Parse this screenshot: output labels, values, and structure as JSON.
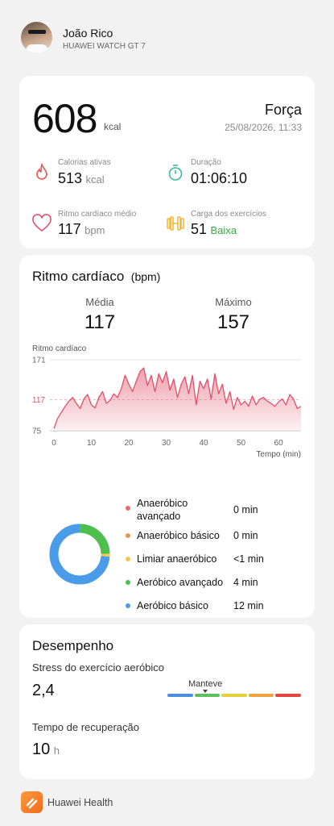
{
  "header": {
    "user_name": "João Rico",
    "device": "HUAWEI WATCH GT 7"
  },
  "summary": {
    "calories": "608",
    "calories_unit": "kcal",
    "workout_type": "Força",
    "datetime": "25/08/2026, 11:33",
    "stats": [
      {
        "label": "Calorias ativas",
        "value": "513",
        "unit": "kcal",
        "icon": "flame-icon"
      },
      {
        "label": "Duração",
        "value": "01:06:10",
        "unit": "",
        "icon": "stopwatch-icon"
      },
      {
        "label": "Ritmo cardíaco médio",
        "value": "117",
        "unit": "bpm",
        "icon": "heart-icon"
      },
      {
        "label": "Carga dos exercícios",
        "value": "51",
        "unit": "Baixa",
        "icon": "dumbbell-icon"
      }
    ],
    "colors": {
      "flame": "#e8584f",
      "stopwatch": "#3bb8a0",
      "heart": "#e0506a",
      "dumbbell": "#f2b233",
      "low_load": "#3aa845"
    }
  },
  "heart_rate": {
    "title": "Ritmo cardíaco",
    "unit": "(bpm)",
    "avg_label": "Média",
    "avg_value": "117",
    "max_label": "Máximo",
    "max_value": "157",
    "chart_label": "Ritmo cardíaco",
    "x_axis_label": "Tempo (min)"
  },
  "chart_data": {
    "type": "area",
    "title": "",
    "xlabel": "Tempo (min)",
    "ylabel": "Ritmo cardíaco",
    "xlim": [
      0,
      66
    ],
    "ylim": [
      75,
      171
    ],
    "x_ticks": [
      0,
      10,
      20,
      30,
      40,
      50,
      60
    ],
    "y_ticks": [
      75,
      117,
      171
    ],
    "highlight_y": 117,
    "color": "#e0506a",
    "x": [
      0,
      1,
      2,
      3,
      4,
      5,
      6,
      7,
      8,
      9,
      10,
      11,
      12,
      13,
      14,
      15,
      16,
      17,
      18,
      19,
      20,
      21,
      22,
      23,
      24,
      25,
      26,
      27,
      28,
      29,
      30,
      31,
      32,
      33,
      34,
      35,
      36,
      37,
      38,
      39,
      40,
      41,
      42,
      43,
      44,
      45,
      46,
      47,
      48,
      49,
      50,
      51,
      52,
      53,
      54,
      55,
      56,
      57,
      58,
      59,
      60,
      61,
      62,
      63,
      64,
      65,
      66
    ],
    "values": [
      78,
      92,
      100,
      108,
      115,
      120,
      112,
      105,
      118,
      124,
      110,
      106,
      120,
      128,
      112,
      116,
      125,
      120,
      132,
      150,
      138,
      128,
      142,
      155,
      160,
      136,
      150,
      128,
      152,
      140,
      155,
      130,
      145,
      120,
      138,
      148,
      125,
      150,
      110,
      142,
      132,
      145,
      118,
      152,
      125,
      138,
      112,
      128,
      104,
      120,
      110,
      115,
      108,
      122,
      110,
      118,
      120,
      115,
      112,
      108,
      114,
      118,
      110,
      124,
      118,
      105,
      108
    ]
  },
  "zones": {
    "items": [
      {
        "name": "Anaeróbico avançado",
        "value": "0 min",
        "color": "#ee6a6a"
      },
      {
        "name": "Anaeróbico básico",
        "value": "0 min",
        "color": "#f0954a"
      },
      {
        "name": "Limiar anaeróbico",
        "value": "<1 min",
        "color": "#f2c94c"
      },
      {
        "name": "Aeróbico avançado",
        "value": "4 min",
        "color": "#4cbf4f"
      },
      {
        "name": "Aeróbico básico",
        "value": "12 min",
        "color": "#4a9ce8"
      }
    ],
    "donut_minutes": [
      0,
      0,
      0.3,
      4,
      12
    ]
  },
  "performance": {
    "title": "Desempenho",
    "stress_label": "Stress do exercício aeróbico",
    "stress_value": "2,4",
    "stress_status": "Manteve",
    "scale_colors": [
      "#4a8fe0",
      "#5cc15c",
      "#e4d13a",
      "#f0a23a",
      "#e2463c"
    ],
    "recovery_label": "Tempo de recuperação",
    "recovery_value": "10",
    "recovery_unit": "h"
  },
  "footer": {
    "app_name": "Huawei Health"
  }
}
